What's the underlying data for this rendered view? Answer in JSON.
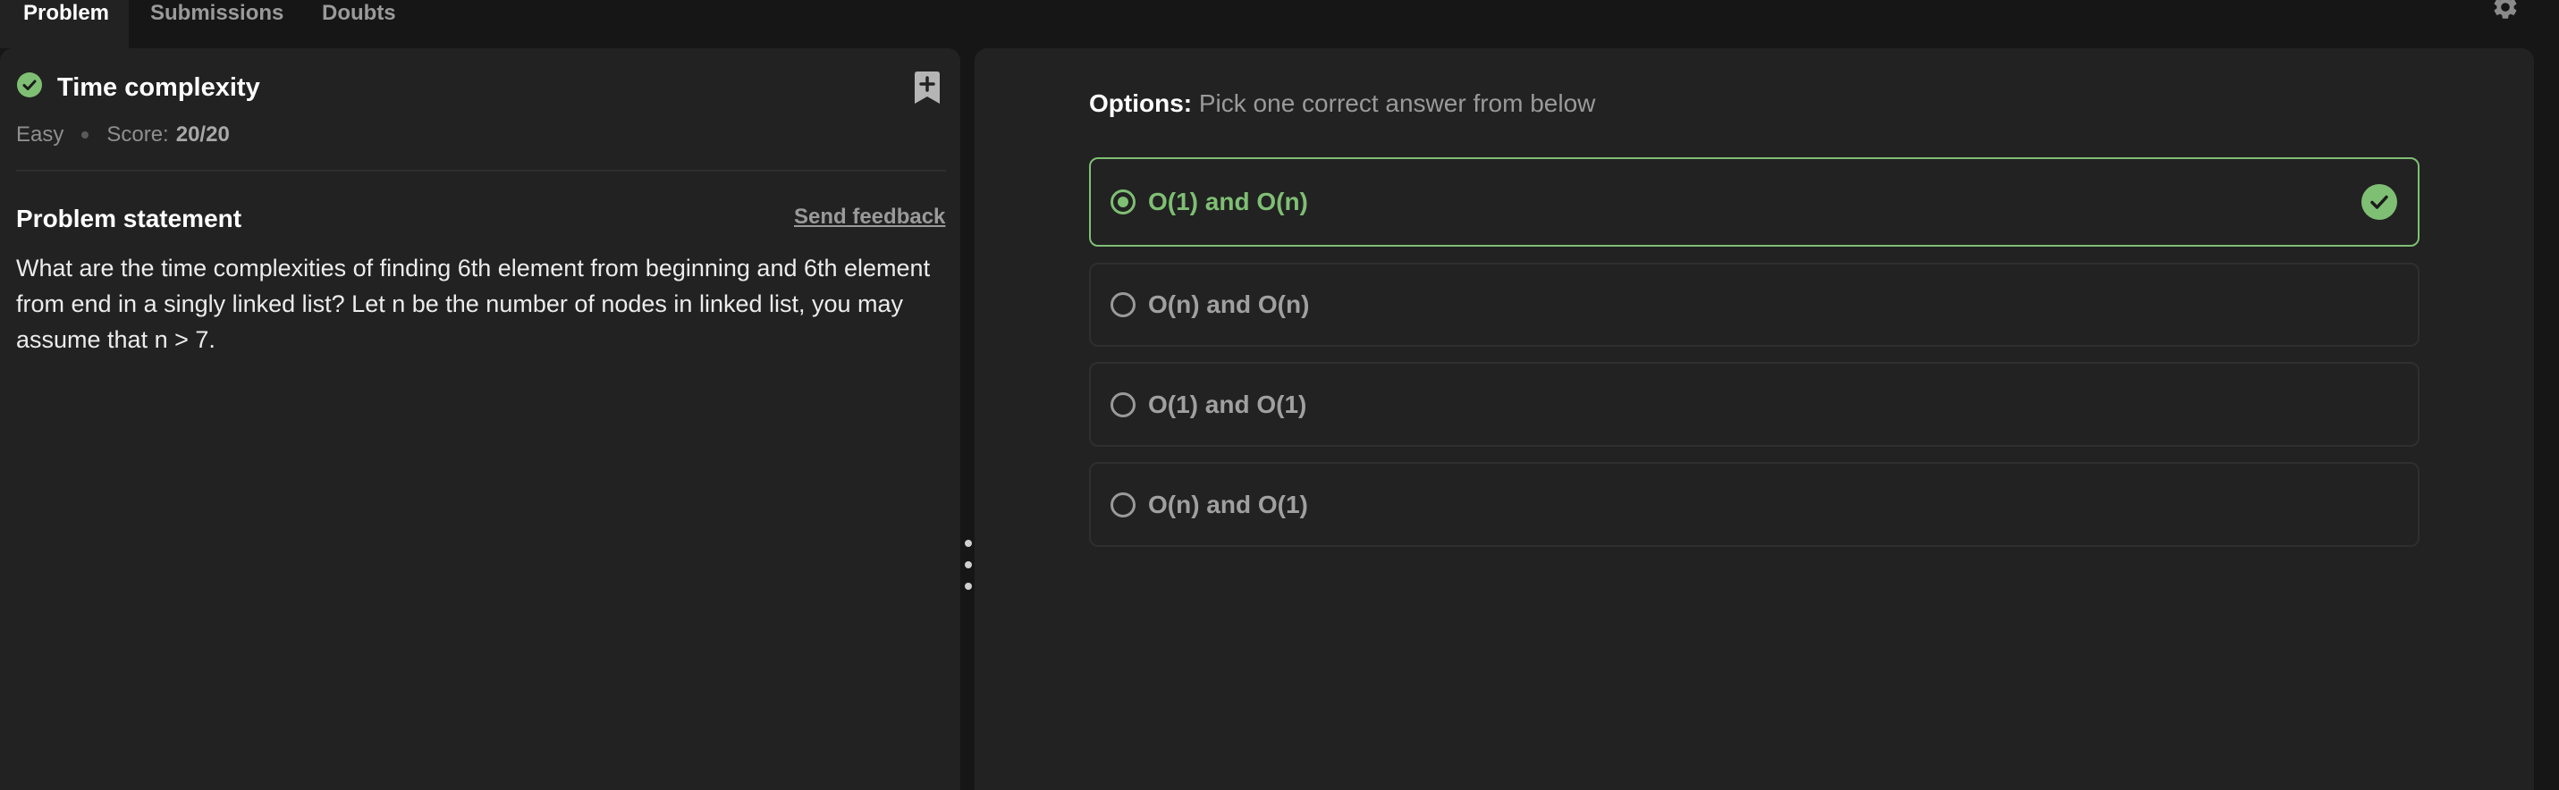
{
  "tabs": [
    {
      "label": "Problem",
      "active": true
    },
    {
      "label": "Submissions",
      "active": false
    },
    {
      "label": "Doubts",
      "active": false
    }
  ],
  "problem": {
    "title": "Time complexity",
    "difficulty": "Easy",
    "score_label": "Score:",
    "score_value": "20/20",
    "statement_heading": "Problem statement",
    "feedback_link": "Send feedback",
    "statement": "What are the time complexities of finding 6th element from beginning and 6th element from end in a singly linked list? Let n be the number of nodes in linked list, you may assume that n > 7."
  },
  "options_section": {
    "heading": "Options:",
    "subheading": "Pick one correct answer from below",
    "options": [
      {
        "label": "O(1) and O(n)",
        "selected": true,
        "correct": true
      },
      {
        "label": "O(n) and O(n)",
        "selected": false,
        "correct": false
      },
      {
        "label": "O(1) and O(1)",
        "selected": false,
        "correct": false
      },
      {
        "label": "O(n) and O(1)",
        "selected": false,
        "correct": false
      }
    ]
  },
  "icons": {
    "status": "check-circle-icon",
    "bookmark": "bookmark-add-icon",
    "settings": "gear-icon",
    "correct": "check-circle-icon",
    "resizer": "drag-handle-icon"
  },
  "colors": {
    "accent_green": "#7fbf74",
    "panel_bg": "#222222",
    "page_bg": "#161616"
  }
}
